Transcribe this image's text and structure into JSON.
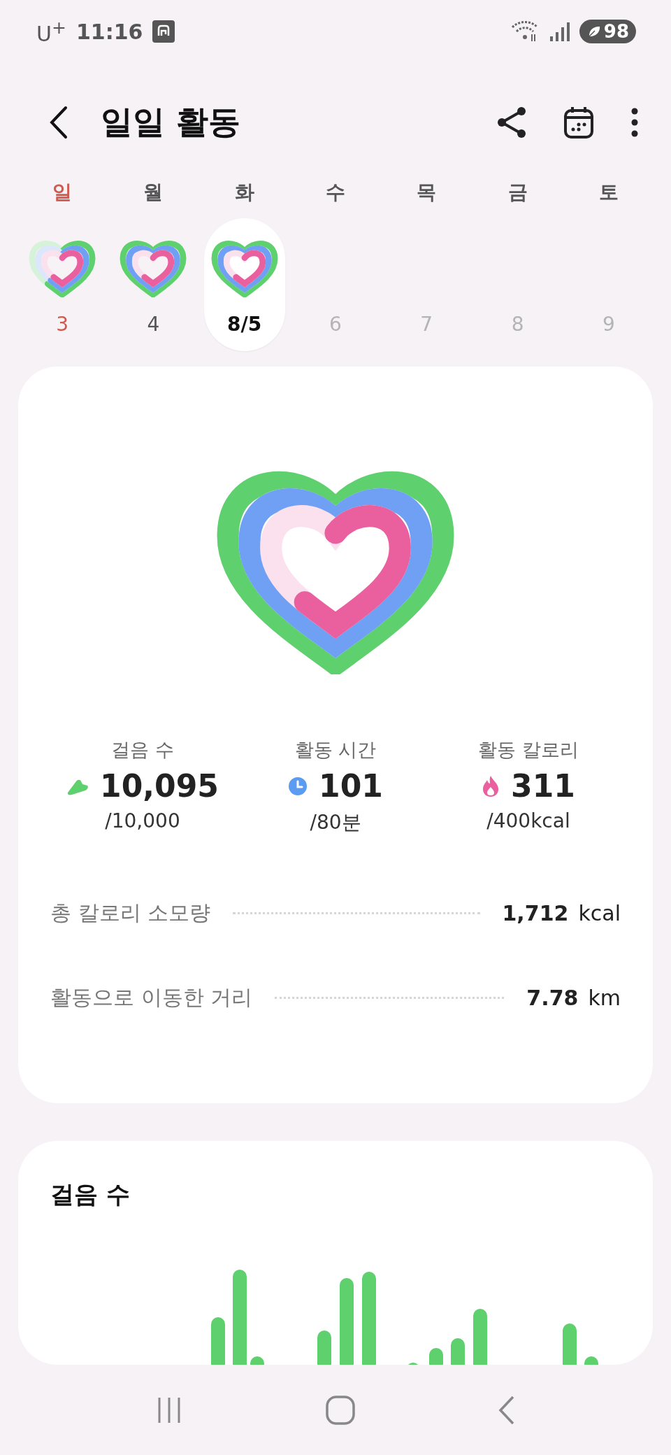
{
  "status_bar": {
    "carrier": "U$^{+}$",
    "time": "11:16",
    "battery": "98"
  },
  "header": {
    "title": "일일 활동"
  },
  "week": [
    {
      "day": "일",
      "date": "3",
      "kind": "sunday",
      "selected": false,
      "future": false,
      "rings": [
        {
          "kind": "steps",
          "complete": false
        },
        {
          "kind": "time",
          "complete": false
        },
        {
          "kind": "calories",
          "complete": false
        }
      ]
    },
    {
      "day": "월",
      "date": "4",
      "kind": "weekday",
      "selected": false,
      "future": false,
      "rings": [
        {
          "kind": "steps",
          "complete": true
        },
        {
          "kind": "time",
          "complete": true
        },
        {
          "kind": "calories",
          "complete": false
        }
      ]
    },
    {
      "day": "화",
      "date": "8/5",
      "kind": "weekday",
      "selected": true,
      "future": false,
      "rings": [
        {
          "kind": "steps",
          "complete": true
        },
        {
          "kind": "time",
          "complete": true
        },
        {
          "kind": "calories",
          "complete": false
        }
      ]
    },
    {
      "day": "수",
      "date": "6",
      "kind": "weekday",
      "selected": false,
      "future": true
    },
    {
      "day": "목",
      "date": "7",
      "kind": "weekday",
      "selected": false,
      "future": true
    },
    {
      "day": "금",
      "date": "8",
      "kind": "weekday",
      "selected": false,
      "future": true
    },
    {
      "day": "토",
      "date": "9",
      "kind": "weekday",
      "selected": false,
      "future": true
    }
  ],
  "summary": {
    "rings": [
      {
        "kind": "steps",
        "complete": true
      },
      {
        "kind": "time",
        "complete": true
      },
      {
        "kind": "calories",
        "complete": false
      }
    ],
    "stats": [
      {
        "kind": "steps",
        "label": "걸음 수",
        "value": "10,095",
        "goal": "/10,000"
      },
      {
        "kind": "time",
        "label": "활동 시간",
        "value": "101",
        "goal": "/80분"
      },
      {
        "kind": "calories",
        "label": "활동 칼로리",
        "value": "311",
        "goal": "/400kcal"
      }
    ],
    "details": [
      {
        "label": "총 칼로리 소모량",
        "value": "1,712",
        "unit": "kcal"
      },
      {
        "label": "활동으로 이동한 거리",
        "value": "7.78",
        "unit": "km"
      }
    ]
  },
  "steps_card": {
    "title": "걸음 수"
  }
}
